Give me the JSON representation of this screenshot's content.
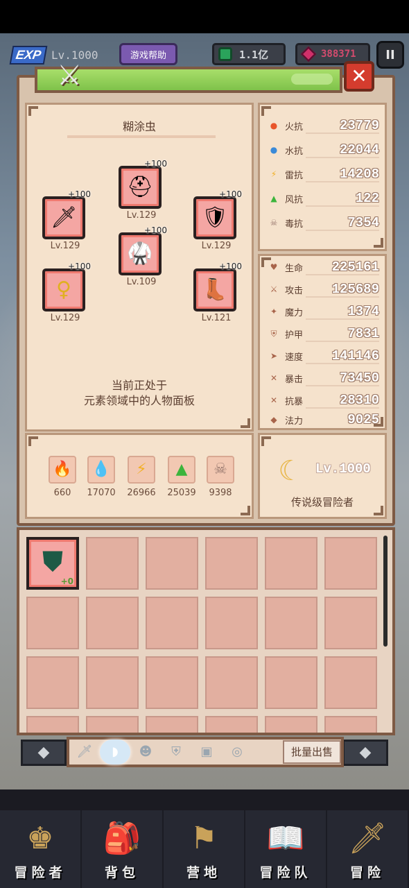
{
  "hud": {
    "exp_label": "EXP",
    "level": "Lv.1000",
    "help_button": "游戏帮助",
    "gems": "1.1亿",
    "rubies": "388371",
    "pause": "II"
  },
  "panel": {
    "close": "✕",
    "character_name": "糊涂虫",
    "message_line1": "当前正处于",
    "message_line2": "元素领域中的人物面板"
  },
  "equipment": [
    {
      "slot": "weapon",
      "icon": "sword-icon",
      "glyph": "🗡",
      "plus": "+100",
      "level": "Lv.129"
    },
    {
      "slot": "helmet",
      "icon": "helmet-icon",
      "glyph": "⛑",
      "plus": "+100",
      "level": "Lv.129"
    },
    {
      "slot": "shield",
      "icon": "shield-icon",
      "glyph": "🛡",
      "plus": "+100",
      "level": "Lv.129"
    },
    {
      "slot": "armor",
      "icon": "armor-icon",
      "glyph": "🥋",
      "plus": "+100",
      "level": "Lv.109"
    },
    {
      "slot": "necklace",
      "icon": "necklace-icon",
      "glyph": "♀",
      "plus": "+100",
      "level": "Lv.129"
    },
    {
      "slot": "boots",
      "icon": "boots-icon",
      "glyph": "👢",
      "plus": "+100",
      "level": "Lv.121"
    }
  ],
  "elements": [
    {
      "name": "fire",
      "icon": "fire-element-icon",
      "glyph": "🔥",
      "value": "660",
      "color": "#e8552a"
    },
    {
      "name": "water",
      "icon": "water-element-icon",
      "glyph": "💧",
      "value": "17070",
      "color": "#3a8ad8"
    },
    {
      "name": "thunder",
      "icon": "thunder-element-icon",
      "glyph": "⚡",
      "value": "26966",
      "color": "#f2b025"
    },
    {
      "name": "wind",
      "icon": "wind-element-icon",
      "glyph": "▲",
      "value": "25039",
      "color": "#3cb43c"
    },
    {
      "name": "poison",
      "icon": "poison-element-icon",
      "glyph": "☠",
      "value": "9398",
      "color": "#9a7a70"
    }
  ],
  "resistances": [
    {
      "label": "火抗",
      "value": "23779",
      "icon": "fire-resist-icon",
      "glyph": "●",
      "color": "#e8552a"
    },
    {
      "label": "水抗",
      "value": "22044",
      "icon": "water-resist-icon",
      "glyph": "●",
      "color": "#3a8ad8"
    },
    {
      "label": "雷抗",
      "value": "14208",
      "icon": "thunder-resist-icon",
      "glyph": "⚡",
      "color": "#f2b025"
    },
    {
      "label": "风抗",
      "value": "122",
      "icon": "wind-resist-icon",
      "glyph": "▲",
      "color": "#3cb43c"
    },
    {
      "label": "毒抗",
      "value": "7354",
      "icon": "poison-resist-icon",
      "glyph": "☠",
      "color": "#9a7a70"
    }
  ],
  "stats": [
    {
      "label": "生命",
      "value": "225161",
      "icon": "heart-icon",
      "glyph": "♥"
    },
    {
      "label": "攻击",
      "value": "125689",
      "icon": "attack-icon",
      "glyph": "⚔"
    },
    {
      "label": "魔力",
      "value": "1374",
      "icon": "magic-icon",
      "glyph": "✦"
    },
    {
      "label": "护甲",
      "value": "7831",
      "icon": "armor-stat-icon",
      "glyph": "⛨"
    },
    {
      "label": "速度",
      "value": "141146",
      "icon": "speed-icon",
      "glyph": "➤"
    },
    {
      "label": "暴击",
      "value": "73450",
      "icon": "crit-icon",
      "glyph": "✕"
    },
    {
      "label": "抗暴",
      "value": "28310",
      "icon": "crit-resist-icon",
      "glyph": "✕"
    },
    {
      "label": "法力",
      "value": "9025",
      "icon": "mana-icon",
      "glyph": "◆"
    }
  ],
  "rank": {
    "level": "Lv.1000",
    "title": "传说级冒险者"
  },
  "inventory": {
    "first_item_plus": "+0",
    "sell_button": "批量出售"
  },
  "tabs": [
    {
      "name": "tab-weapons",
      "icon": "sword-tab-icon",
      "glyph": "🗡"
    },
    {
      "name": "tab-armor",
      "icon": "armor-tab-icon",
      "glyph": "◗"
    },
    {
      "name": "tab-helmets",
      "icon": "helmet-tab-icon",
      "glyph": "☻"
    },
    {
      "name": "tab-chest",
      "icon": "chest-tab-icon",
      "glyph": "⛨"
    },
    {
      "name": "tab-accessories",
      "icon": "accessory-tab-icon",
      "glyph": "▣"
    },
    {
      "name": "tab-rings",
      "icon": "ring-tab-icon",
      "glyph": "◎"
    }
  ],
  "nav": [
    {
      "label": "冒险者",
      "icon": "adventurer-nav-icon",
      "glyph": "♚"
    },
    {
      "label": "背包",
      "icon": "backpack-nav-icon",
      "glyph": "🎒"
    },
    {
      "label": "营地",
      "icon": "camp-nav-icon",
      "glyph": "⚑"
    },
    {
      "label": "冒险队",
      "icon": "team-nav-icon",
      "glyph": "📖"
    },
    {
      "label": "冒险",
      "icon": "adventure-nav-icon",
      "glyph": "🗡"
    }
  ]
}
